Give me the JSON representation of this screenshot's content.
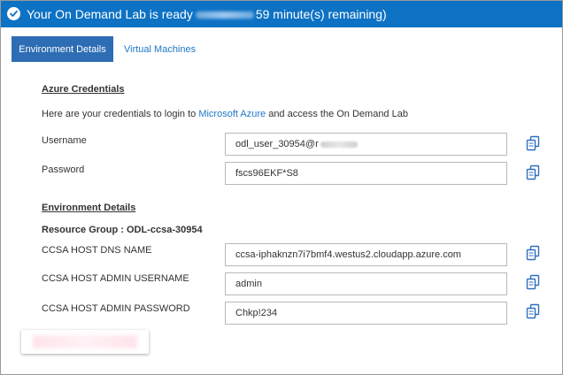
{
  "banner": {
    "prefix": "Your On Demand Lab is ready",
    "suffix": "59 minute(s) remaining)"
  },
  "tabs": [
    {
      "label": "Environment Details",
      "active": true
    },
    {
      "label": "Virtual Machines",
      "active": false
    }
  ],
  "azure": {
    "title": "Azure Credentials",
    "intro_before": "Here are your credentials to login to ",
    "intro_link": "Microsoft Azure",
    "intro_after": " and access the On Demand Lab",
    "username_label": "Username",
    "username_value": "odl_user_30954@r",
    "password_label": "Password",
    "password_value": "fscs96EKF*S8"
  },
  "env": {
    "title": "Environment Details",
    "resource_group": "Resource Group : ODL-ccsa-30954",
    "dns_label": "CCSA HOST DNS NAME",
    "dns_value": "ccsa-iphaknzn7i7bmf4.westus2.cloudapp.azure.com",
    "admin_user_label": "CCSA HOST ADMIN USERNAME",
    "admin_user_value": "admin",
    "admin_pass_label": "CCSA HOST ADMIN PASSWORD",
    "admin_pass_value": "Chkp!234"
  },
  "colors": {
    "banner": "#0e72c4",
    "active_tab": "#2d6db4",
    "link": "#1f77c9"
  },
  "icons": {
    "banner": "check-circle-icon",
    "copy": "copy-icon"
  }
}
